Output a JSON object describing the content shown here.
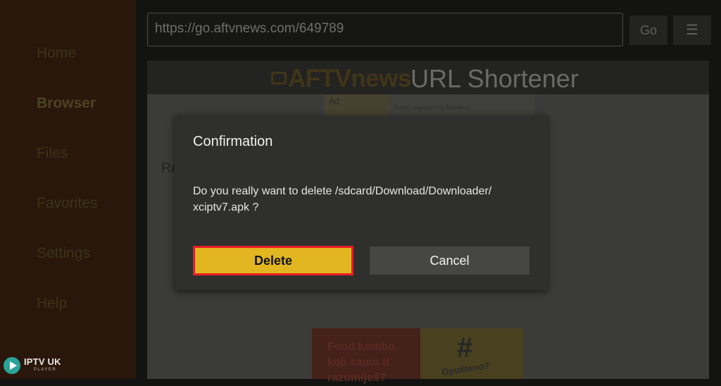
{
  "sidebar": {
    "items": [
      {
        "label": "Home"
      },
      {
        "label": "Browser"
      },
      {
        "label": "Files"
      },
      {
        "label": "Favorites"
      },
      {
        "label": "Settings"
      },
      {
        "label": "Help"
      }
    ]
  },
  "toolbar": {
    "url_value": "https://go.aftvnews.com/649789",
    "go_label": "Go",
    "menu_icon": "☰"
  },
  "site": {
    "logo_text": "AFTVnews",
    "title_rest": "URL Shortener",
    "ad_label": "Ad",
    "ad_text": "Svratí srijedom na McMenu",
    "partial_heading": "Re",
    "bottom_ad_text": "Food kombo\nkoji samo ti\nrazumiješ?",
    "bottom_ad_sub": "Opušteno?"
  },
  "dialog": {
    "title": "Confirmation",
    "message": "Do you really want to delete /sdcard/Download/Downloader/\nxciptv7.apk ?",
    "delete_label": "Delete",
    "cancel_label": "Cancel"
  },
  "watermark": {
    "title": "IPTV UK",
    "subtitle": "PLAYER"
  },
  "colors": {
    "accent_yellow": "#e2b621",
    "highlight_red": "#ea1c24",
    "dialog_bg": "#2f302e",
    "sidebar_bg": "#2a170c"
  }
}
